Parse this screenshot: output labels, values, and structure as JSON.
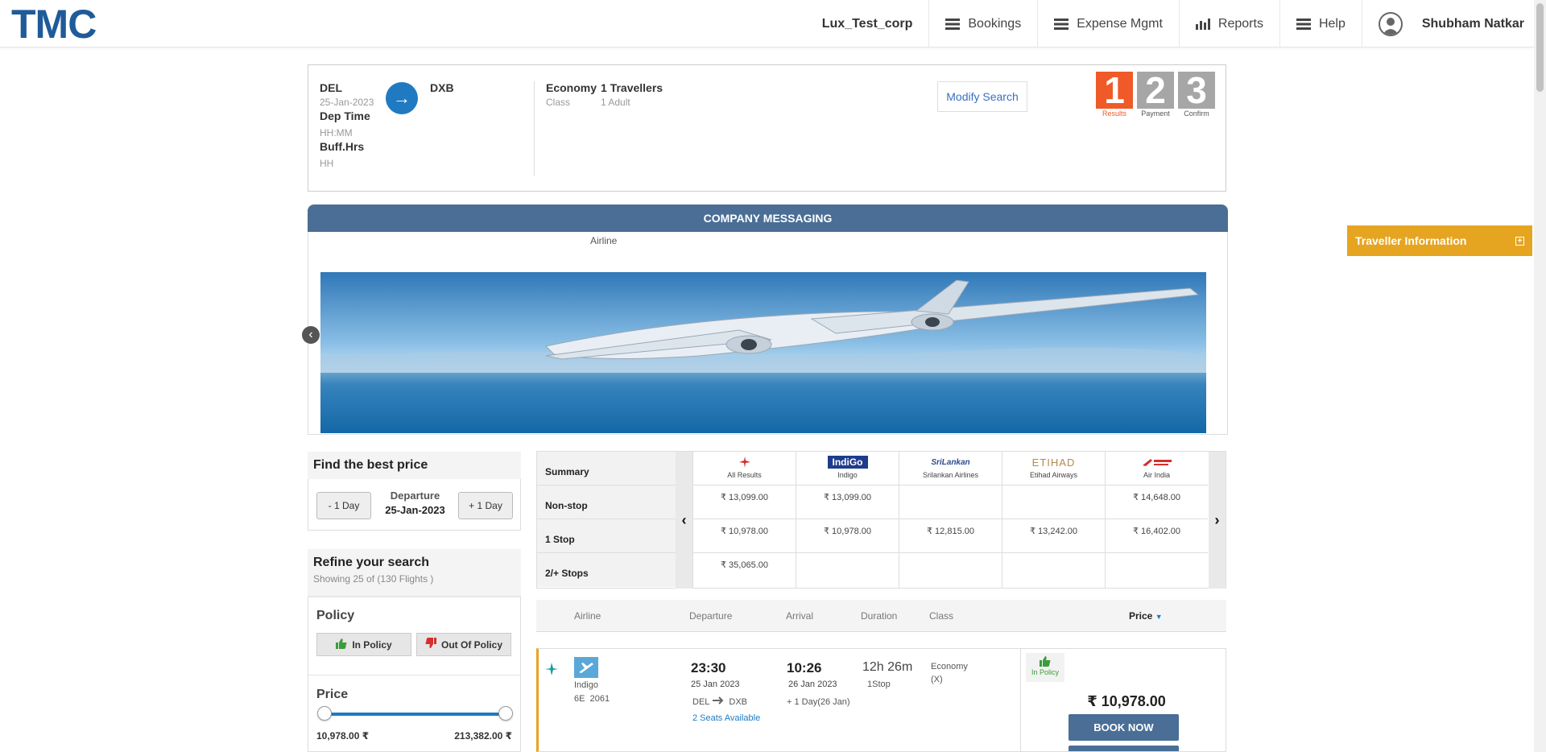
{
  "header": {
    "logo": "TMC",
    "corp": "Lux_Test_corp",
    "nav": [
      "Bookings",
      "Expense Mgmt",
      "Reports",
      "Help"
    ],
    "user": "Shubham Natkar"
  },
  "search": {
    "from": "DEL",
    "to": "DXB",
    "date": "25-Jan-2023",
    "dep_time_label": "Dep Time",
    "dep_time_value": "HH:MM",
    "buff_label": "Buff.Hrs",
    "buff_value": "HH",
    "class_value": "Economy",
    "class_label": "Class",
    "travellers_value": "1 Travellers",
    "travellers_sub": "1 Adult",
    "modify_label": "Modify Search",
    "arrow": "→"
  },
  "steps": [
    {
      "num": "1",
      "label": "Results"
    },
    {
      "num": "2",
      "label": "Payment"
    },
    {
      "num": "3",
      "label": "Confirm"
    }
  ],
  "messaging": {
    "title": "COMPANY MESSAGING",
    "caption": "Airline"
  },
  "traveller": {
    "label": "Traveller Information",
    "toggle": "+"
  },
  "best_price": {
    "title": "Find the best price",
    "minus": "- 1 Day",
    "plus": "+ 1 Day",
    "dep_label": "Departure",
    "dep_date": "25-Jan-2023"
  },
  "refine": {
    "title": "Refine your search",
    "sub": "Showing 25 of (130 Flights )",
    "policy_title": "Policy",
    "in_policy": "In Policy",
    "out_policy": "Out Of Policy",
    "price_title": "Price",
    "price_min": "10,978.00 ₹",
    "price_max": "213,382.00 ₹"
  },
  "matrix": {
    "rows": [
      "Summary",
      "Non-stop",
      "1 Stop",
      "2/+ Stops"
    ],
    "prev": "‹",
    "next": "›",
    "airlines": [
      {
        "name": "All Results",
        "logo": "plane-logo",
        "cells": [
          "₹ 13,099.00",
          "₹ 10,978.00",
          "₹ 35,065.00"
        ]
      },
      {
        "name": "Indigo",
        "logo": "IndiGo",
        "cells": [
          "₹ 13,099.00",
          "₹ 10,978.00",
          ""
        ]
      },
      {
        "name": "Srilankan Airlines",
        "logo": "SriLankan",
        "cells": [
          "",
          "₹ 12,815.00",
          ""
        ]
      },
      {
        "name": "Etihad Airways",
        "logo": "ETIHAD",
        "cells": [
          "",
          "₹ 13,242.00",
          ""
        ]
      },
      {
        "name": "Air India",
        "logo": "air-india-logo",
        "cells": [
          "₹ 14,648.00",
          "₹ 16,402.00",
          ""
        ]
      }
    ]
  },
  "result_header": {
    "airline": "Airline",
    "departure": "Departure",
    "arrival": "Arrival",
    "duration": "Duration",
    "class": "Class",
    "price": "Price"
  },
  "result": {
    "airline": "Indigo",
    "flight_code": "6E",
    "flight_no": "2061",
    "dep_time": "23:30",
    "dep_date": "25 Jan 2023",
    "route_from": "DEL",
    "route_to": "DXB",
    "seats": "2 Seats Available",
    "arr_time": "10:26",
    "arr_date": "26 Jan 2023",
    "arr_note": "+ 1 Day(26 Jan)",
    "duration": "12h 26m",
    "stops": "1Stop",
    "class": "Economy",
    "class_code": "(X)",
    "policy": "In Policy",
    "fare": "₹ 10,978.00",
    "book": "BOOK NOW"
  },
  "colors": {
    "brand": "#1f5b99",
    "header_bar": "#4a6e95",
    "accent_orange": "#e6a521",
    "step_active": "#f05a28",
    "link_blue": "#1f7ac2"
  }
}
